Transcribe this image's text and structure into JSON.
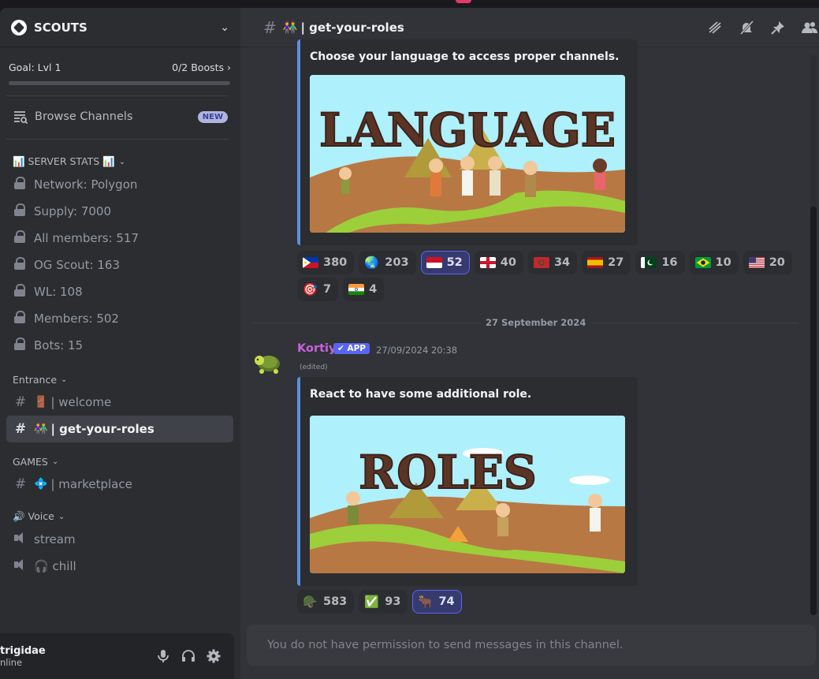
{
  "server": {
    "name": "SCOUTS"
  },
  "boost": {
    "goal": "Goal: Lvl 1",
    "count": "0/2 Boosts",
    "progress": 0
  },
  "browse": {
    "label": "Browse Channels",
    "badge": "NEW"
  },
  "sidebar": {
    "stats_category": "📊 SERVER STATS 📊",
    "stats": [
      "Network: Polygon",
      "Supply: 7000",
      "All members: 517",
      "OG Scout: 163",
      "WL: 108",
      "Members: 502",
      "Bots: 15"
    ],
    "entrance_category": "Entrance",
    "entrance": [
      {
        "emoji": "🚪",
        "name": "| welcome"
      },
      {
        "emoji": "👫",
        "name": "| get-your-roles"
      }
    ],
    "games_category": "GAMES",
    "games": [
      {
        "emoji": "💠",
        "name": "| marketplace"
      }
    ],
    "voice_category": "🔊 Voice",
    "voice": [
      {
        "name": "stream"
      },
      {
        "name": "🎧 chill"
      }
    ]
  },
  "user": {
    "name": "trigidae",
    "status": "nline"
  },
  "channel": {
    "emoji": "👫",
    "name": "| get-your-roles"
  },
  "embed1": {
    "title": "Choose your language to access proper channels.",
    "image_text": "LANGUAGE"
  },
  "reactions1": [
    {
      "emoji": "ph",
      "count": "380",
      "active": false
    },
    {
      "emoji": "🌏",
      "count": "203",
      "active": false
    },
    {
      "emoji": "id",
      "count": "52",
      "active": true
    },
    {
      "emoji": "gb",
      "count": "40",
      "active": false
    },
    {
      "emoji": "ma",
      "count": "34",
      "active": false
    },
    {
      "emoji": "es",
      "count": "27",
      "active": false
    },
    {
      "emoji": "pk",
      "count": "16",
      "active": false
    },
    {
      "emoji": "br",
      "count": "10",
      "active": false
    },
    {
      "emoji": "us",
      "count": "20",
      "active": false
    }
  ],
  "reactions1b": [
    {
      "emoji": "🎯",
      "count": "7",
      "active": false
    },
    {
      "emoji": "in",
      "count": "4",
      "active": false
    }
  ],
  "date_divider": "27 September 2024",
  "message": {
    "author": "Kortiy",
    "badge": "✔ APP",
    "time": "27/09/2024 20:38",
    "edited": "(edited)"
  },
  "embed2": {
    "title": "React to have some additional role.",
    "image_text": "ROLES"
  },
  "reactions2": [
    {
      "emoji": "🪖",
      "count": "583",
      "active": false
    },
    {
      "emoji": "✅",
      "count": "93",
      "active": false
    },
    {
      "emoji": "🐂",
      "count": "74",
      "active": true
    }
  ],
  "composer": {
    "placeholder": "You do not have permission to send messages in this channel."
  },
  "colors": {
    "accent": "#5865f2",
    "author": "#c763e0",
    "embed_border": "#5d8fe0"
  }
}
